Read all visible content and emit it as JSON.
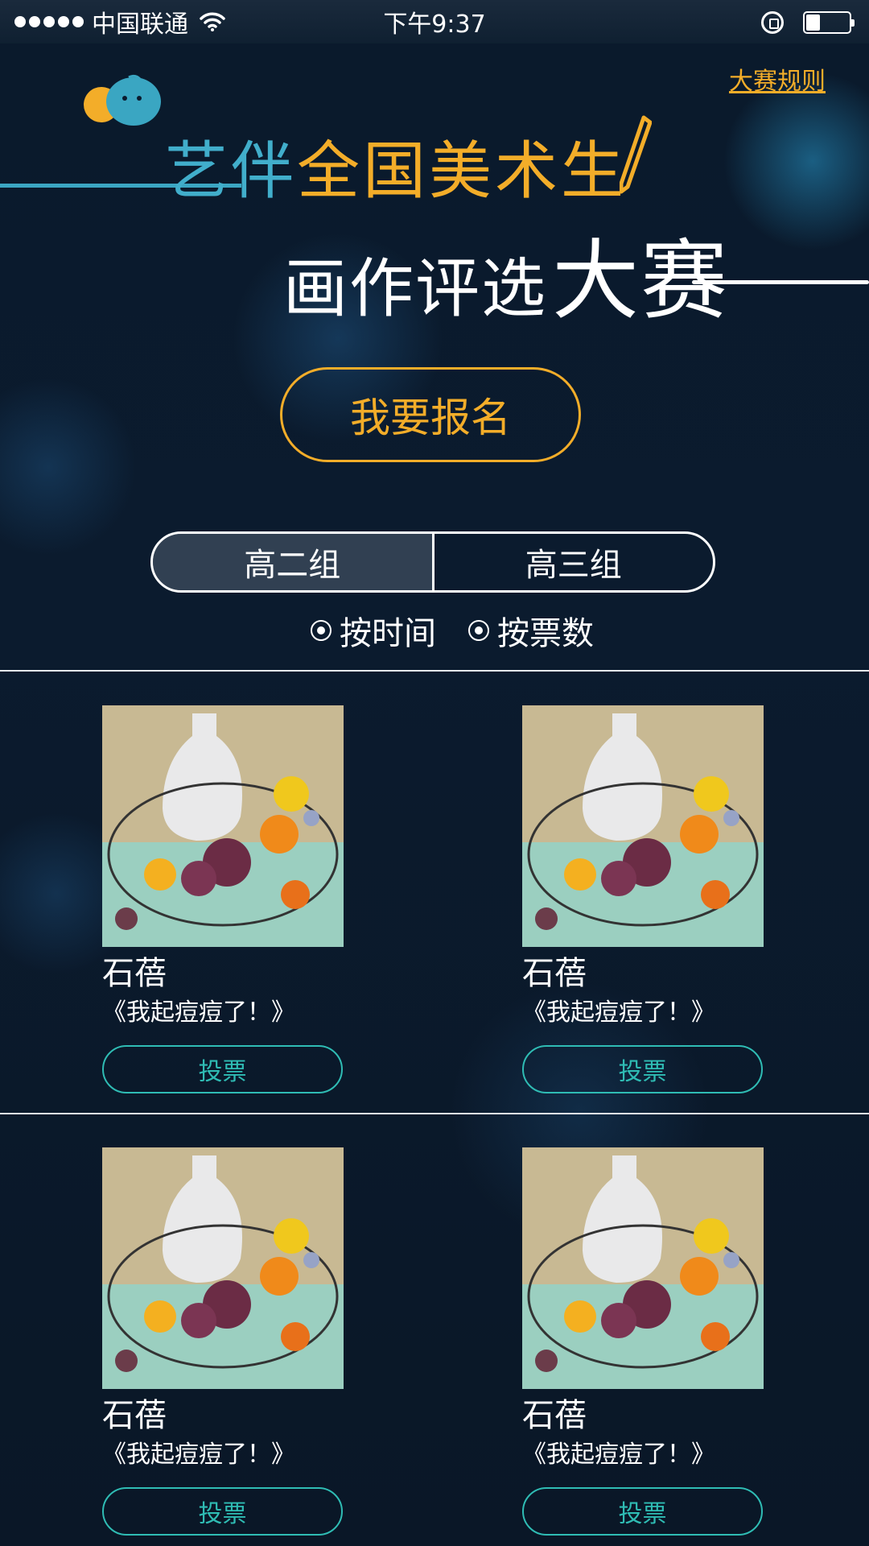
{
  "status": {
    "carrier": "中国联通",
    "time": "下午9:37",
    "battery_level": 0.32
  },
  "header": {
    "rules_link": "大赛规则",
    "title_part1": "艺伴",
    "title_part2": "全国美术生",
    "title_line2": "画作评选",
    "title_line2_big": "大赛"
  },
  "signup_button": "我要报名",
  "groups": {
    "tabs": [
      "高二组",
      "高三组"
    ],
    "active": "高二组"
  },
  "sort": {
    "options": [
      "按时间",
      "按票数"
    ]
  },
  "entries": [
    {
      "artist": "石蓓",
      "title": "《我起痘痘了！》",
      "vote_label": "投票"
    },
    {
      "artist": "石蓓",
      "title": "《我起痘痘了！》",
      "vote_label": "投票"
    },
    {
      "artist": "石蓓",
      "title": "《我起痘痘了！》",
      "vote_label": "投票"
    },
    {
      "artist": "石蓓",
      "title": "《我起痘痘了！》",
      "vote_label": "投票"
    }
  ],
  "colors": {
    "accent_orange": "#f3ad29",
    "accent_teal": "#2fbcb4",
    "title_blue": "#41aecb",
    "background": "#0a1a2c"
  },
  "icons": [
    "wifi-icon",
    "rotation-lock-icon",
    "battery-icon",
    "mascot-icon",
    "pencil-icon",
    "radio-icon"
  ]
}
